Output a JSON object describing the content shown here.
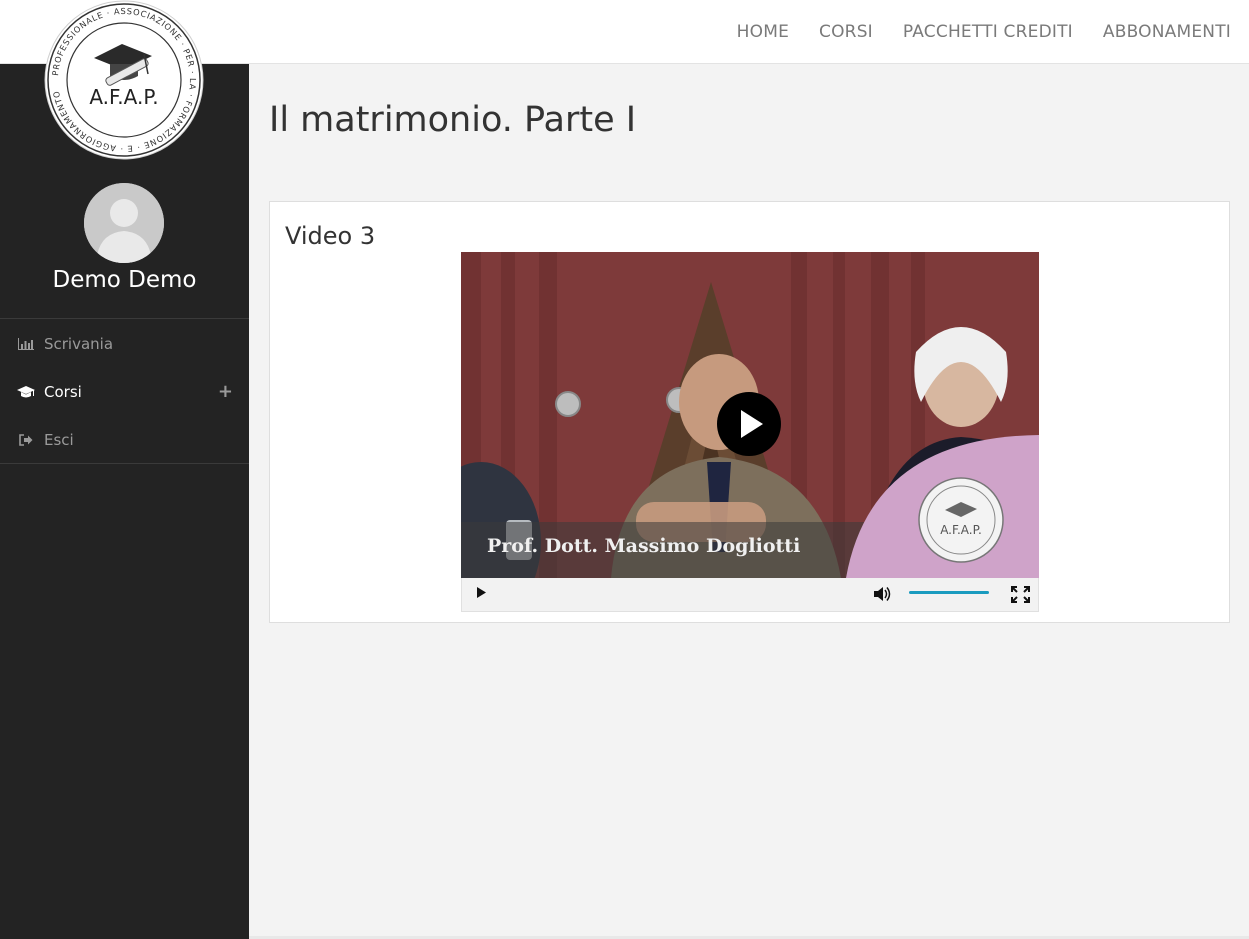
{
  "nav": {
    "home": "HOME",
    "corsi": "CORSI",
    "pacchetti": "PACCHETTI CREDITI",
    "abbonamenti": "ABBONAMENTI"
  },
  "logo": {
    "text": "A.F.A.P.",
    "ring_text": "PROFESSIONALE · ASSOCIAZIONE · PER · LA · FORMAZIONE · E · AGGIORNAMENTO"
  },
  "sidebar": {
    "user_name": "Demo Demo",
    "items": [
      {
        "label": "Scrivania",
        "icon": "bar-chart-icon"
      },
      {
        "label": "Corsi",
        "icon": "graduation-cap-icon"
      },
      {
        "label": "Esci",
        "icon": "sign-out-icon"
      }
    ]
  },
  "main": {
    "page_title": "Il matrimonio. Parte I",
    "panel_title": "Video 3",
    "video_caption": "Prof. Dott. Massimo Dogliotti",
    "video_watermark": "A.F.A.P.",
    "volume_level": 1.0
  },
  "colors": {
    "sidebar_bg": "#232323",
    "accent": "#1a9bbf",
    "watermark_pink": "#cfa3c9"
  }
}
